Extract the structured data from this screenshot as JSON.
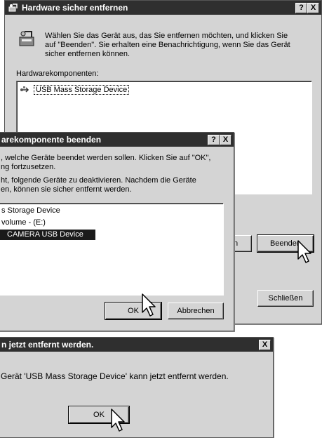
{
  "dialog_main": {
    "title": "Hardware sicher entfernen",
    "help_btn": "?",
    "close_btn": "X",
    "instr_line1": "Wählen Sie das Gerät aus, das Sie entfernen möchten, und klicken Sie",
    "instr_line2": "auf \"Beenden\". Sie erhalten eine Benachrichtigung, wenn Sie das Gerät",
    "instr_line3": "sicher entfernen können.",
    "list_label": "Hardwarekomponenten:",
    "list_items": [
      "USB Mass Storage Device"
    ],
    "btn_partial": "en",
    "btn_beenden": "Beenden",
    "btn_schliessen": "Schließen"
  },
  "dialog_stop": {
    "title": "arekomponente beenden",
    "help_btn": "?",
    "close_btn": "X",
    "text_line1": ", welche Geräte beendet werden sollen. Klicken Sie auf \"OK\",",
    "text_line2": "ng fortzusetzen.",
    "text_line3": "ht, folgende Geräte zu deaktivieren. Nachdem die Geräte",
    "text_line4": "en, können sie sicher entfernt werden.",
    "list_items": [
      "s Storage Device",
      "volume - (E:)",
      "CAMERA USB Device"
    ],
    "btn_ok": "OK",
    "btn_cancel": "Abbrechen"
  },
  "dialog_remove": {
    "title": "n jetzt entfernt werden.",
    "close_btn": "X",
    "message": "Gerät 'USB Mass Storage Device' kann jetzt entfernt werden.",
    "btn_ok": "OK"
  },
  "colors": {
    "titlebar": "#2f2f2f",
    "face": "#d4d4d4",
    "selection": "#1a1a1a"
  }
}
